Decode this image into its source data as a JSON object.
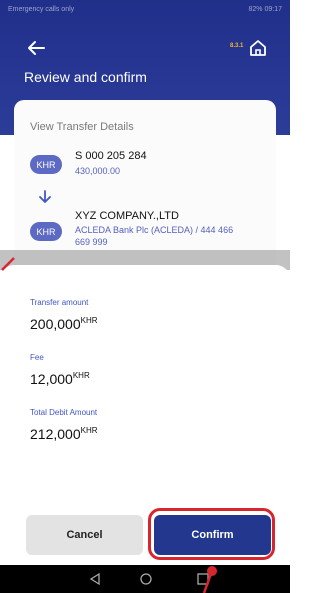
{
  "status_bar": {
    "left": "Emergency calls only",
    "right": "82% 09:17"
  },
  "header": {
    "title": "Review and confirm",
    "version": "8.3.1"
  },
  "transfer_details": {
    "section_title": "View Transfer Details",
    "from": {
      "currency": "KHR",
      "account": "S 000 205 284",
      "amount": "430,000.00"
    },
    "to": {
      "currency": "KHR",
      "name": "XYZ COMPANY.,LTD",
      "bank_line1": "ACLEDA Bank Plc (ACLEDA) / 444 466",
      "bank_line2": "669 999"
    }
  },
  "summary": {
    "transfer_amount": {
      "label": "Transfer amount",
      "value": "200,000",
      "currency": "KHR"
    },
    "fee": {
      "label": "Fee",
      "value": "12,000",
      "currency": "KHR"
    },
    "total": {
      "label": "Total Debit Amount",
      "value": "212,000",
      "currency": "KHR"
    }
  },
  "buttons": {
    "cancel": "Cancel",
    "confirm": "Confirm"
  },
  "colors": {
    "brand": "#24378f",
    "accent": "#5c6ac4",
    "highlight": "#d8262e"
  }
}
